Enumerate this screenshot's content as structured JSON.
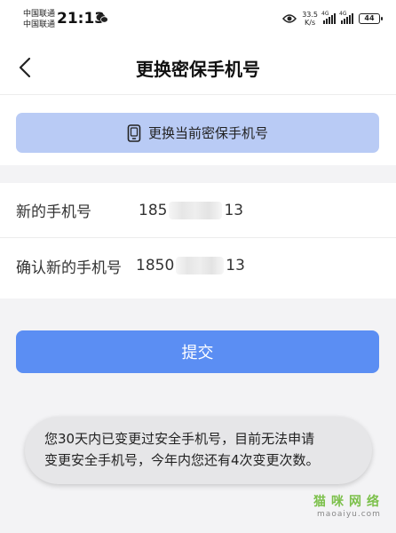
{
  "status_bar": {
    "carrier_1": "中国联通",
    "carrier_2": "中国联通",
    "time": "21:13",
    "speed_value": "33.5",
    "speed_unit": "K/s",
    "network_1": "4G",
    "network_2": "4G",
    "battery": "44"
  },
  "header": {
    "title": "更换密保手机号"
  },
  "change_section": {
    "button_label": "更换当前密保手机号"
  },
  "form": {
    "new_phone_label": "新的手机号",
    "new_phone_prefix": "185",
    "new_phone_suffix": "13",
    "confirm_phone_label": "确认新的手机号",
    "confirm_phone_prefix": "1850",
    "confirm_phone_suffix": "13"
  },
  "submit": {
    "label": "提交"
  },
  "toast": {
    "line1": "您30天内已变更过安全手机号，目前无法申请",
    "line2": "变更安全手机号，今年内您还有4次变更次数。"
  },
  "watermark": {
    "text_cn": "猫咪网络",
    "text_en": "maoaiyu.com"
  },
  "colors": {
    "primary": "#5b8ef3",
    "secondary_button": "#b9cbf5",
    "watermark_green": "#7cc04b"
  },
  "icons": {
    "back": "chevron-left-icon",
    "phone": "phone-icon",
    "eye": "eye-icon",
    "wechat": "wechat-icon"
  }
}
